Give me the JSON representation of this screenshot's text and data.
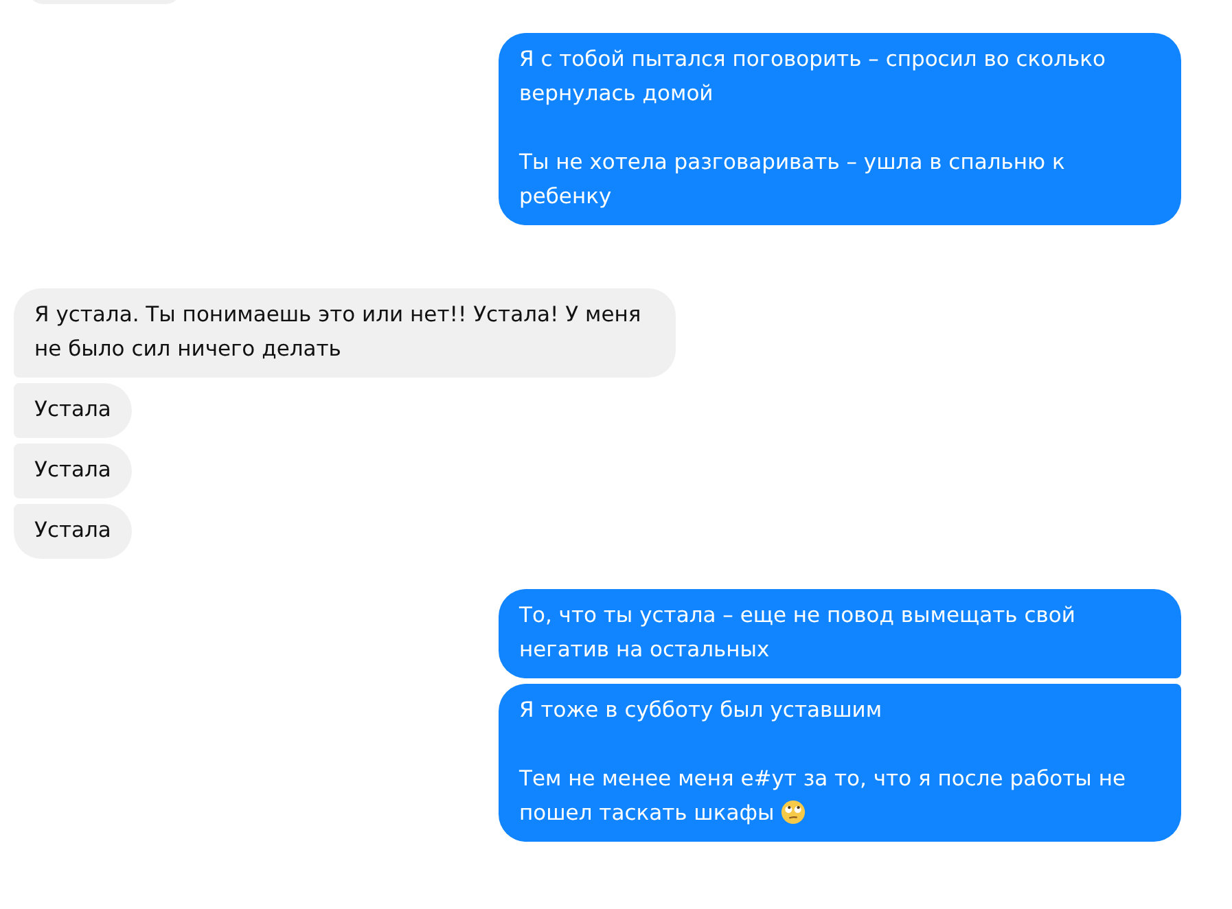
{
  "groups": [
    {
      "kind": "outgoing",
      "messages": [
        {
          "paragraphs": [
            "Я с тобой пытался поговорить – спросил во сколько вернулась домой",
            "Ты не хотела разговаривать – ушла в спальню к ребенку"
          ]
        }
      ]
    },
    {
      "kind": "incoming",
      "messages": [
        {
          "paragraphs": [
            "Я устала. Ты понимаешь это или нет!! Устала! У меня не было сил ничего делать"
          ]
        },
        {
          "paragraphs": [
            "Устала"
          ]
        },
        {
          "paragraphs": [
            "Устала"
          ]
        },
        {
          "paragraphs": [
            "Устала"
          ]
        }
      ]
    },
    {
      "kind": "outgoing",
      "messages": [
        {
          "paragraphs": [
            "То, что ты устала – еще не повод вымещать свой негатив на остальных"
          ]
        },
        {
          "paragraphs": [
            "Я тоже в субботу был уставшим",
            "Тем не менее меня е#ут за то, что я после работы не пошел таскать шкафы"
          ],
          "emoji": true
        }
      ]
    }
  ]
}
